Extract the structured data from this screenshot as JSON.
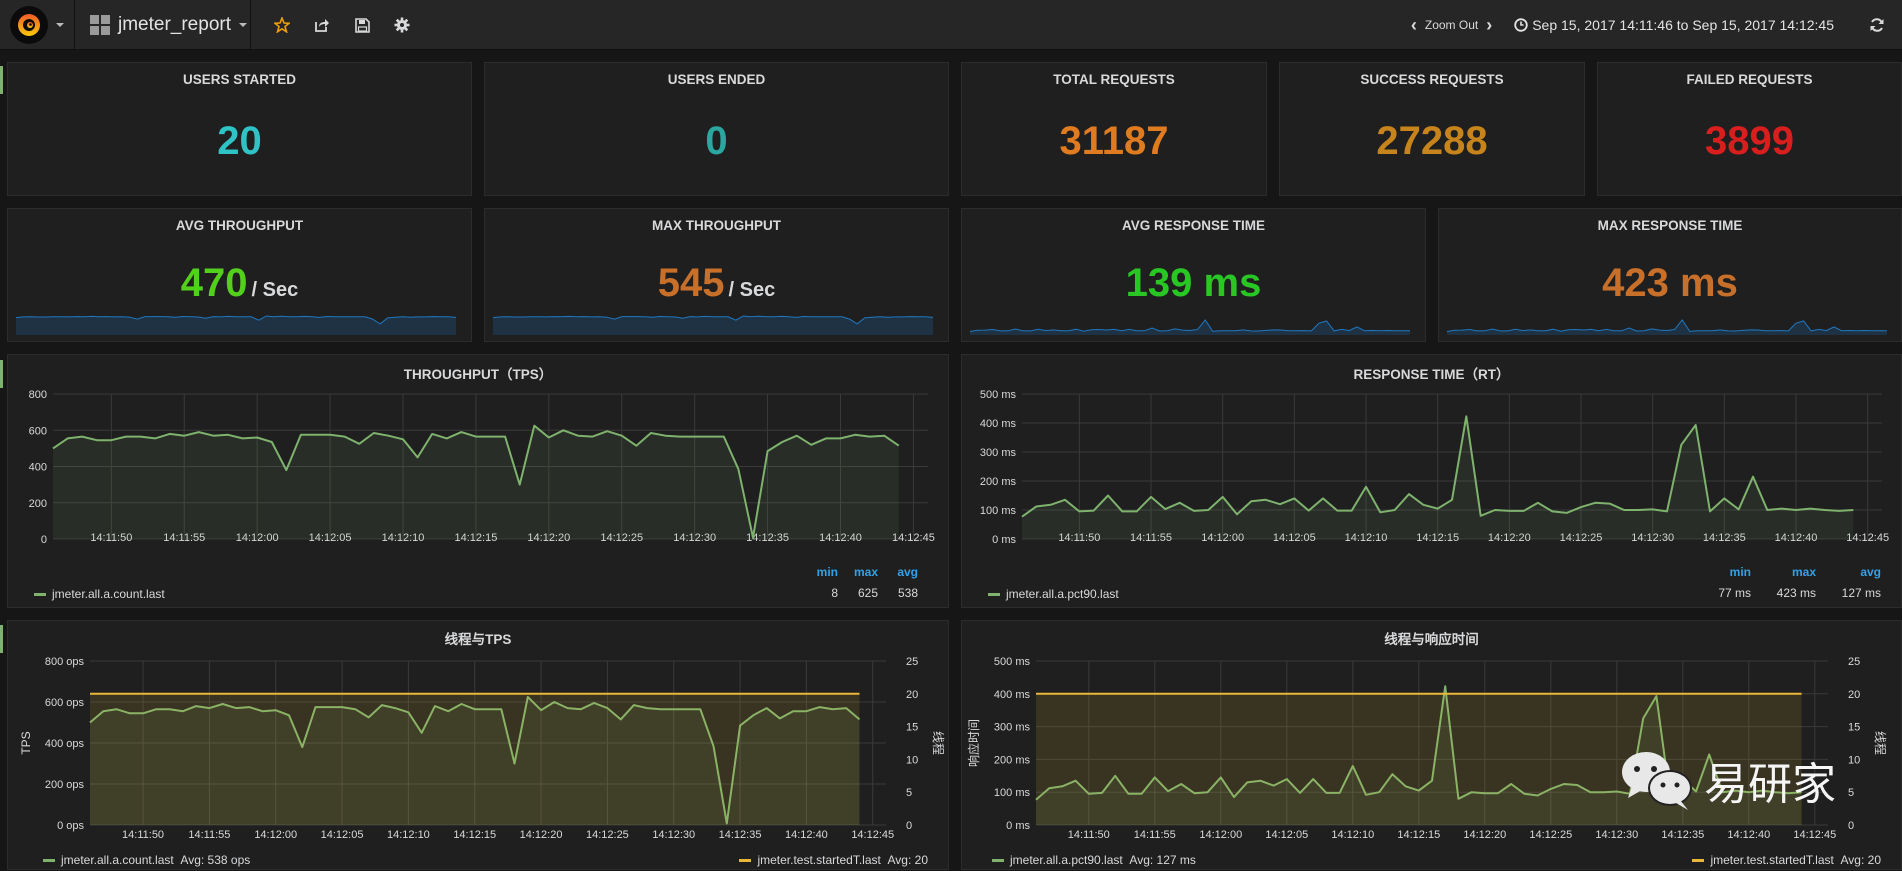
{
  "navbar": {
    "dashboard_title": "jmeter_report",
    "zoom_out_label": "Zoom Out",
    "time_range": "Sep 15, 2017 14:11:46 to Sep 15, 2017 14:12:45",
    "icons": [
      "grafana-logo-icon",
      "star-icon",
      "share-icon",
      "save-icon",
      "settings-gear-icon",
      "clock-icon",
      "refresh-icon"
    ]
  },
  "stats_row1": [
    {
      "title": "USERS STARTED",
      "value": "20",
      "color": "#2fc3c5"
    },
    {
      "title": "USERS ENDED",
      "value": "0",
      "color": "#2ba6a0"
    },
    {
      "title": "TOTAL REQUESTS",
      "value": "31187",
      "color": "#e07c1f"
    },
    {
      "title": "SUCCESS REQUESTS",
      "value": "27288",
      "color": "#c8841c"
    },
    {
      "title": "FAILED REQUESTS",
      "value": "3899",
      "color": "#d91e1e"
    }
  ],
  "stats_row2": [
    {
      "title": "AVG THROUGHPUT",
      "value": "470",
      "unit": "/ Sec",
      "color": "#52d01c"
    },
    {
      "title": "MAX THROUGHPUT",
      "value": "545",
      "unit": "/ Sec",
      "color": "#c8702a"
    },
    {
      "title": "AVG RESPONSE TIME",
      "value": "139 ms",
      "unit": "",
      "color": "#29c724"
    },
    {
      "title": "MAX RESPONSE TIME",
      "value": "423 ms",
      "unit": "",
      "color": "#c8702a"
    }
  ],
  "colors": {
    "series_green": "#7eb26d",
    "series_yellow": "#eab839",
    "legend_header": "#33a2e5",
    "spark_line": "#1f78c1"
  },
  "chart_data": [
    {
      "id": "throughput",
      "type": "line",
      "title": "THROUGHPUT（TPS）",
      "xlabel": "",
      "ylabel": "",
      "ylim": [
        0,
        800
      ],
      "yticks": [
        "0",
        "200",
        "400",
        "600",
        "800"
      ],
      "xticks": [
        "14:11:50",
        "14:11:55",
        "14:12:00",
        "14:12:05",
        "14:12:10",
        "14:12:15",
        "14:12:20",
        "14:12:25",
        "14:12:30",
        "14:12:35",
        "14:12:40",
        "14:12:45"
      ],
      "x_start": "14:11:46",
      "x_end": "14:12:45",
      "x_step_seconds": 1,
      "grid": true,
      "series": [
        {
          "name": "jmeter.all.a.count.last",
          "color": "#7eb26d",
          "values": [
            500,
            555,
            565,
            545,
            545,
            565,
            565,
            555,
            580,
            570,
            590,
            570,
            575,
            555,
            560,
            535,
            380,
            575,
            575,
            575,
            565,
            525,
            585,
            570,
            550,
            450,
            580,
            555,
            590,
            565,
            565,
            565,
            300,
            625,
            560,
            600,
            570,
            565,
            595,
            570,
            515,
            585,
            570,
            565,
            565,
            565,
            565,
            385,
            8,
            485,
            535,
            570,
            520,
            555,
            555,
            575,
            565,
            570,
            515
          ]
        }
      ],
      "legend": {
        "placement": "bottom-left",
        "columns": [
          "min",
          "max",
          "avg"
        ],
        "values": [
          "8",
          "625",
          "538"
        ]
      }
    },
    {
      "id": "response_time",
      "type": "line",
      "title": "RESPONSE TIME（RT）",
      "xlabel": "",
      "ylabel": "",
      "ylim": [
        0,
        500
      ],
      "yticks": [
        "0 ms",
        "100 ms",
        "200 ms",
        "300 ms",
        "400 ms",
        "500 ms"
      ],
      "xticks": [
        "14:11:50",
        "14:11:55",
        "14:12:00",
        "14:12:05",
        "14:12:10",
        "14:12:15",
        "14:12:20",
        "14:12:25",
        "14:12:30",
        "14:12:35",
        "14:12:40",
        "14:12:45"
      ],
      "x_start": "14:11:46",
      "x_end": "14:12:45",
      "x_step_seconds": 1,
      "grid": true,
      "series": [
        {
          "name": "jmeter.all.a.pct90.last",
          "color": "#7eb26d",
          "values": [
            77,
            112,
            118,
            135,
            95,
            98,
            150,
            95,
            95,
            145,
            103,
            125,
            97,
            100,
            145,
            85,
            130,
            135,
            120,
            140,
            98,
            140,
            98,
            98,
            180,
            92,
            100,
            155,
            118,
            105,
            135,
            423,
            80,
            100,
            97,
            97,
            125,
            95,
            90,
            110,
            125,
            122,
            100,
            100,
            102,
            95,
            325,
            393,
            95,
            140,
            102,
            215,
            100,
            105,
            100,
            105,
            100,
            97,
            100
          ]
        }
      ],
      "legend": {
        "placement": "bottom-left",
        "columns": [
          "min",
          "max",
          "avg"
        ],
        "values": [
          "77 ms",
          "423 ms",
          "127 ms"
        ]
      }
    },
    {
      "id": "threads_tps",
      "type": "line",
      "title": "线程与TPS",
      "xlabel": "",
      "ylabel": "TPS",
      "ylabel_right": "线程",
      "ylim": [
        0,
        800
      ],
      "ylim_right": [
        0,
        25
      ],
      "yticks": [
        "0 ops",
        "200 ops",
        "400 ops",
        "600 ops",
        "800 ops"
      ],
      "yticks_right": [
        "0",
        "5",
        "10",
        "15",
        "20",
        "25"
      ],
      "xticks": [
        "14:11:50",
        "14:11:55",
        "14:12:00",
        "14:12:05",
        "14:12:10",
        "14:12:15",
        "14:12:20",
        "14:12:25",
        "14:12:30",
        "14:12:35",
        "14:12:40",
        "14:12:45"
      ],
      "x_start": "14:11:46",
      "x_end": "14:12:45",
      "x_step_seconds": 1,
      "grid": true,
      "series": [
        {
          "name": "jmeter.all.a.count.last",
          "color": "#7eb26d",
          "axis": "left",
          "legend_text": "Avg: 538 ops",
          "values": [
            500,
            555,
            565,
            545,
            545,
            565,
            565,
            555,
            580,
            570,
            590,
            570,
            575,
            555,
            560,
            535,
            380,
            575,
            575,
            575,
            565,
            525,
            585,
            570,
            550,
            450,
            580,
            555,
            590,
            565,
            565,
            565,
            300,
            625,
            560,
            600,
            570,
            565,
            595,
            570,
            515,
            585,
            570,
            565,
            565,
            565,
            565,
            385,
            8,
            485,
            535,
            570,
            520,
            555,
            555,
            575,
            565,
            570,
            515
          ]
        },
        {
          "name": "jmeter.test.startedT.last",
          "color": "#eab839",
          "axis": "right",
          "legend_text": "Avg: 20",
          "constant": 20
        }
      ],
      "legend": {
        "placement": "bottom"
      }
    },
    {
      "id": "threads_rt",
      "type": "line",
      "title": "线程与响应时间",
      "xlabel": "",
      "ylabel": "响应时间",
      "ylabel_right": "线程",
      "ylim": [
        0,
        500
      ],
      "ylim_right": [
        0,
        25
      ],
      "yticks": [
        "0 ms",
        "100 ms",
        "200 ms",
        "300 ms",
        "400 ms",
        "500 ms"
      ],
      "yticks_right": [
        "0",
        "5",
        "10",
        "15",
        "20",
        "25"
      ],
      "xticks": [
        "14:11:50",
        "14:11:55",
        "14:12:00",
        "14:12:05",
        "14:12:10",
        "14:12:15",
        "14:12:20",
        "14:12:25",
        "14:12:30",
        "14:12:35",
        "14:12:40",
        "14:12:45"
      ],
      "x_start": "14:11:46",
      "x_end": "14:12:45",
      "x_step_seconds": 1,
      "grid": true,
      "series": [
        {
          "name": "jmeter.all.a.pct90.last",
          "color": "#7eb26d",
          "axis": "left",
          "legend_text": "Avg: 127 ms",
          "values": [
            77,
            112,
            118,
            135,
            95,
            98,
            150,
            95,
            95,
            145,
            103,
            125,
            97,
            100,
            145,
            85,
            130,
            135,
            120,
            140,
            98,
            140,
            98,
            98,
            180,
            92,
            100,
            155,
            118,
            105,
            135,
            423,
            80,
            100,
            97,
            97,
            125,
            95,
            90,
            110,
            125,
            122,
            100,
            100,
            102,
            95,
            325,
            393,
            95,
            140,
            102,
            215,
            100,
            105,
            100,
            105,
            100,
            97,
            100
          ]
        },
        {
          "name": "jmeter.test.startedT.last",
          "color": "#eab839",
          "axis": "right",
          "legend_text": "Avg: 20",
          "constant": 20
        }
      ],
      "legend": {
        "placement": "bottom"
      }
    }
  ],
  "watermark": {
    "text": "易研家",
    "icon": "wechat-icon"
  }
}
